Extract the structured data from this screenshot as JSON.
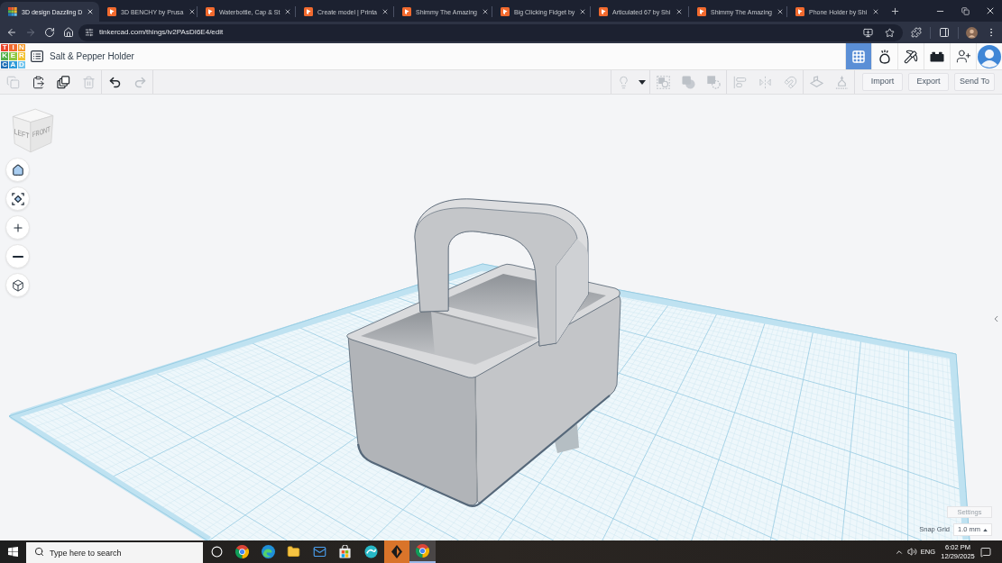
{
  "browser": {
    "tabs": [
      {
        "kind": "grid",
        "title": "3D design Dazzling D",
        "selected": true
      },
      {
        "kind": "tile",
        "title": "3D BENCHY by Prusa",
        "selected": false
      },
      {
        "kind": "tile",
        "title": "Waterbottle, Cap & St",
        "selected": false
      },
      {
        "kind": "tile",
        "title": "Create model | Printa",
        "selected": false
      },
      {
        "kind": "tile",
        "title": "Shimmy The Amazing",
        "selected": false
      },
      {
        "kind": "tile",
        "title": "Big Clicking Fidget by",
        "selected": false
      },
      {
        "kind": "tile",
        "title": "Articulated 67 by Shi",
        "selected": false
      },
      {
        "kind": "tile",
        "title": "Shimmy The Amazing",
        "selected": false
      },
      {
        "kind": "tile",
        "title": "Phone Holder by Shi",
        "selected": false
      }
    ],
    "nav": [
      {
        "kind": "back",
        "disabled": false
      },
      {
        "kind": "forward",
        "disabled": true
      },
      {
        "kind": "reload",
        "disabled": false
      },
      {
        "kind": "home",
        "disabled": false
      }
    ],
    "url": "tinkercad.com/things/iv2PAsDI6E4/edit"
  },
  "app": {
    "logo_letters": [
      "T",
      "I",
      "N",
      "K",
      "E",
      "R",
      "C",
      "A",
      "D"
    ],
    "title": "Salt & Pepper Holder",
    "modes": [
      {
        "kind": "grid",
        "selected": true
      },
      {
        "kind": "blob",
        "selected": false
      },
      {
        "kind": "pickaxe",
        "selected": false
      },
      {
        "kind": "brick",
        "selected": false
      }
    ]
  },
  "toolbar": {
    "edit_tools": [
      {
        "kind": "copy",
        "disabled": true
      },
      {
        "kind": "paste",
        "disabled": false
      },
      {
        "kind": "duplicate",
        "disabled": false
      },
      {
        "kind": "delete",
        "disabled": true
      }
    ],
    "history_tools": [
      {
        "kind": "undo",
        "disabled": false
      },
      {
        "kind": "redo",
        "disabled": true
      }
    ],
    "shape_tool_groups": [
      [
        {
          "kind": "note",
          "disabled": true
        },
        {
          "kind": "menu",
          "disabled": false
        }
      ],
      [
        {
          "kind": "group",
          "disabled": true
        },
        {
          "kind": "solid",
          "disabled": true
        },
        {
          "kind": "hole",
          "disabled": true
        }
      ],
      [
        {
          "kind": "align",
          "disabled": true
        },
        {
          "kind": "mirror",
          "disabled": true
        },
        {
          "kind": "snap",
          "disabled": true
        }
      ],
      [
        {
          "kind": "plane",
          "disabled": true
        },
        {
          "kind": "drop",
          "disabled": true
        }
      ]
    ],
    "buttons": [
      "Import",
      "Export",
      "Send To"
    ]
  },
  "viewport": {
    "view_cube": {
      "faces": [
        "LEFT",
        "FRONT"
      ]
    },
    "view_controls": [
      {
        "kind": "home"
      },
      {
        "kind": "fit"
      },
      {
        "kind": "zoom-in"
      },
      {
        "kind": "zoom-out"
      },
      {
        "kind": "projection"
      }
    ],
    "settings_button": "Settings",
    "snap_grid": {
      "label": "Snap Grid",
      "value": "1.0 mm"
    }
  },
  "taskbar": {
    "search": {
      "placeholder": "Type here to search"
    },
    "apps": [
      {
        "kind": "task-view",
        "active": false
      },
      {
        "kind": "chrome",
        "active": false
      },
      {
        "kind": "edge",
        "active": false
      },
      {
        "kind": "files",
        "active": false
      },
      {
        "kind": "mail",
        "active": false
      },
      {
        "kind": "store",
        "active": false
      },
      {
        "kind": "swirl",
        "active": false
      },
      {
        "kind": "tile",
        "active": false
      },
      {
        "kind": "chrome",
        "active": true
      }
    ],
    "language": "ENG",
    "time": "6:02 PM",
    "date": "12/29/2025"
  }
}
